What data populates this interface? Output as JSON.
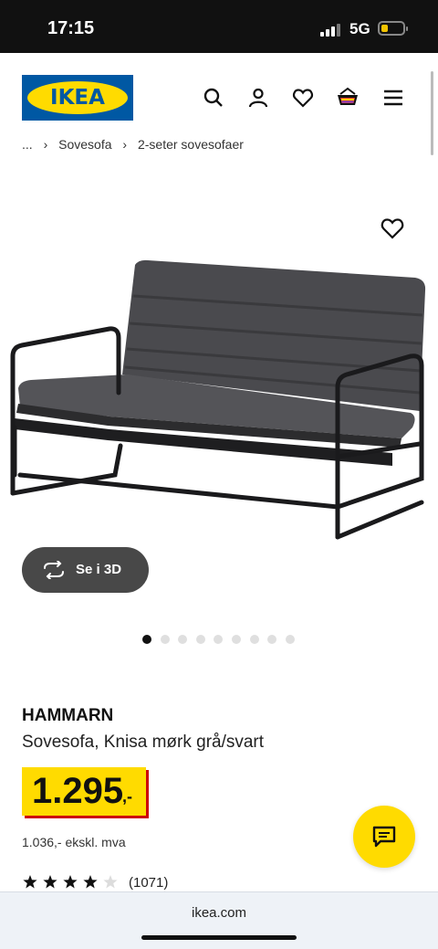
{
  "status_bar": {
    "time": "17:15",
    "network": "5G"
  },
  "header": {
    "logo_text": "IKEA",
    "icons": [
      "search-icon",
      "account-icon",
      "heart-icon",
      "basket-icon",
      "menu-icon"
    ]
  },
  "breadcrumb": {
    "items": [
      "...",
      "Sovesofa",
      "2-seter sovesofaer"
    ],
    "separator": "›"
  },
  "gallery": {
    "view_3d_label": "Se i 3D",
    "dot_count": 9,
    "active_dot": 0
  },
  "product": {
    "name": "HAMMARN",
    "description": "Sovesofa, Knisa mørk grå/svart",
    "price": "1.295",
    "price_suffix": ",-",
    "price_ex_vat": "1.036,- ekskl. mva",
    "rating_value": 4,
    "rating_max": 5,
    "review_count": "(1071)"
  },
  "browser": {
    "url": "ikea.com"
  },
  "colors": {
    "brand_blue": "#0058a3",
    "brand_yellow": "#ffdb00",
    "price_red": "#cc0008"
  }
}
